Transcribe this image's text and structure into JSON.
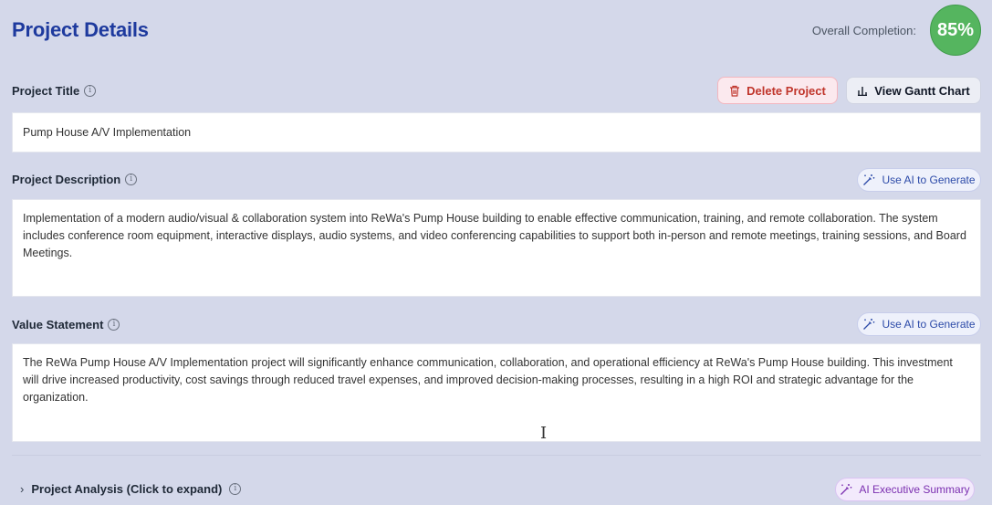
{
  "header": {
    "title": "Project Details",
    "completion_label": "Overall Completion:",
    "completion_value": "85%",
    "completion_color": "#55b55f"
  },
  "actions": {
    "delete_label": "Delete Project",
    "gantt_label": "View Gantt Chart"
  },
  "fields": {
    "title": {
      "label": "Project Title",
      "value": "Pump House A/V Implementation"
    },
    "description": {
      "label": "Project Description",
      "ai_button": "Use AI to Generate",
      "value": "Implementation of a modern audio/visual & collaboration system into ReWa's Pump House building to enable effective communication, training, and remote collaboration. The system includes conference room equipment, interactive displays, audio systems, and video conferencing capabilities to support both in-person and remote meetings, training sessions, and Board Meetings."
    },
    "value_statement": {
      "label": "Value Statement",
      "ai_button": "Use AI to Generate",
      "value": "The ReWa Pump House A/V Implementation project will significantly enhance communication, collaboration, and operational efficiency at ReWa's Pump House building. This investment will drive increased productivity, cost savings through reduced travel expenses, and improved decision-making processes, resulting in a high ROI and strategic advantage for the organization."
    }
  },
  "analysis": {
    "label": "Project Analysis (Click to expand)",
    "exec_button": "AI Executive Summary"
  },
  "icons": {
    "info": "info-icon",
    "trash": "trash-icon",
    "chart": "bar-chart-icon",
    "wand": "magic-wand-icon",
    "chevron": "chevron-right-icon"
  }
}
